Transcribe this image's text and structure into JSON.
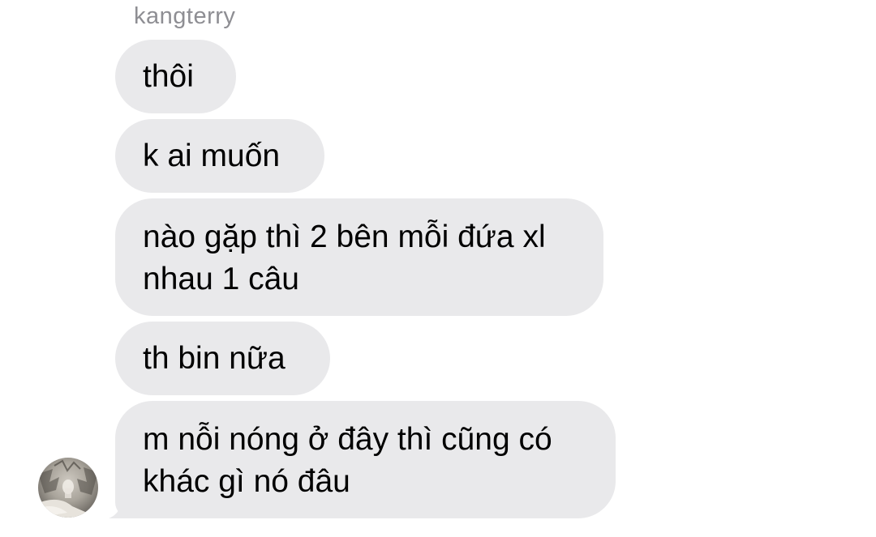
{
  "sender_name": "kangterry",
  "messages": [
    {
      "text": "thôi"
    },
    {
      "text": "k ai muốn"
    },
    {
      "text": "nào gặp thì 2 bên mỗi đứa xl\nnhau 1 câu"
    },
    {
      "text": "th bin nữa"
    },
    {
      "text": "m nỗi nóng ở đây thì cũng có\nkhác gì nó đâu"
    }
  ],
  "colors": {
    "bubble": "#e9e9eb",
    "sender_text": "#8e8e93",
    "message_text": "#000000"
  },
  "icons": {
    "avatar": "avatar-icon"
  }
}
